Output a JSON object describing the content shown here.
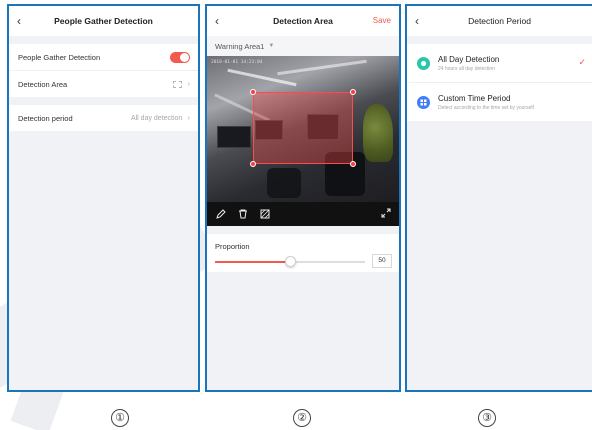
{
  "colors": {
    "accent": "#f05a4f",
    "frame": "#1b75bb",
    "page_bg": "#f1f2f6"
  },
  "panel1": {
    "back_icon": "chevron-left-icon",
    "title": "People Gather Detection",
    "people_gather": {
      "label": "People Gather Detection",
      "enabled": true
    },
    "detection_area": {
      "label": "Detection Area",
      "icon": "area-icon"
    },
    "detection_period": {
      "label": "Detection period",
      "value": "All day detection"
    }
  },
  "panel2": {
    "back_icon": "chevron-left-icon",
    "title": "Detection Area",
    "save_label": "Save",
    "warning_area": "Warning Area1",
    "timestamp": "2018-01-01 14:21:04",
    "tools": [
      "pencil-icon",
      "trash-icon",
      "clear-area-icon"
    ],
    "expand_icon": "fullscreen-icon",
    "proportion": {
      "label": "Proportion",
      "value": 50,
      "max": 100
    }
  },
  "panel3": {
    "back_icon": "chevron-left-icon",
    "title": "Detection Period",
    "options": [
      {
        "title": "All Day Detection",
        "subtitle": "24 hours all day detection",
        "selected": true,
        "icon": "all-day-icon",
        "icon_color": "#29c7a9"
      },
      {
        "title": "Custom Time Period",
        "subtitle": "Detect according to the time set by yourself",
        "selected": false,
        "icon": "custom-period-icon",
        "icon_color": "#3f7ef6"
      }
    ]
  },
  "step_labels": [
    "①",
    "②",
    "③"
  ]
}
